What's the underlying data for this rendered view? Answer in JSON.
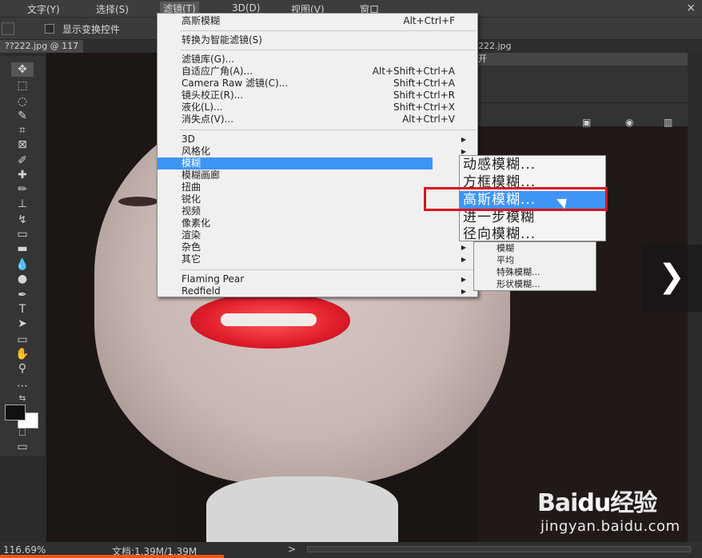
{
  "menubar": {
    "items": [
      "文字(Y)",
      "选择(S)",
      "滤镜(T)",
      "3D(D)",
      "视图(V)",
      "窗口"
    ],
    "close": "×"
  },
  "options": {
    "show_transform": "显示变换控件"
  },
  "tabs": {
    "doc": "??222.jpg @ 117",
    "doc2": "222.jpg"
  },
  "filter_menu": {
    "last": {
      "label": "高斯模糊",
      "shortcut": "Alt+Ctrl+F"
    },
    "smart": "转换为智能滤镜(S)",
    "group1": [
      {
        "label": "滤镜库(G)...",
        "shortcut": ""
      },
      {
        "label": "自适应广角(A)...",
        "shortcut": "Alt+Shift+Ctrl+A"
      },
      {
        "label": "Camera Raw 滤镜(C)...",
        "shortcut": "Shift+Ctrl+A"
      },
      {
        "label": "镜头校正(R)...",
        "shortcut": "Shift+Ctrl+R"
      },
      {
        "label": "液化(L)...",
        "shortcut": "Shift+Ctrl+X"
      },
      {
        "label": "消失点(V)...",
        "shortcut": "Alt+Ctrl+V"
      }
    ],
    "group2": [
      "3D",
      "风格化",
      "模糊",
      "模糊画廊",
      "扭曲",
      "锐化",
      "视频",
      "像素化",
      "渲染",
      "杂色",
      "其它"
    ],
    "group3": [
      "Flaming Pear",
      "Redfield"
    ]
  },
  "blur_submenu": {
    "items": [
      "动感模糊...",
      "方框模糊...",
      "高斯模糊...",
      "进一步模糊",
      "径向模糊..."
    ],
    "highlighted": "高斯模糊..."
  },
  "other_submenu": {
    "items": [
      "模糊",
      "平均",
      "特殊模糊...",
      "形状模糊..."
    ]
  },
  "panel": {
    "title": "开"
  },
  "status": {
    "zoom": "116.69%",
    "doc": "文档:1.39M/1.39M",
    "arrow": ">"
  },
  "watermark": {
    "logo_text": "Bai",
    "logo_suffix": "经验",
    "paw": "du",
    "url": "jingyan.baidu.com"
  },
  "nav": {
    "next": "❯"
  },
  "colors": {
    "highlight": "#3e95f5",
    "redbox": "#d9121c",
    "accent": "#e7571a"
  }
}
